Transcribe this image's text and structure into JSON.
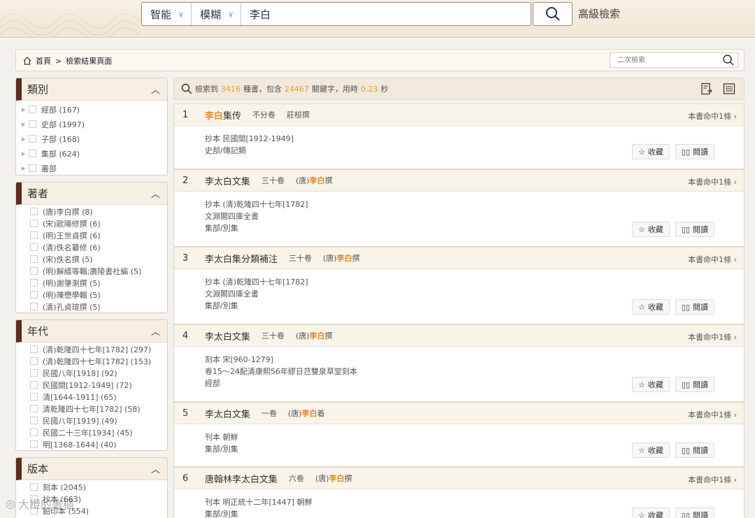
{
  "search": {
    "mode": "智能",
    "match": "模糊",
    "query": "李白",
    "advanced_label": "高級檢索"
  },
  "breadcrumb": {
    "home": "首頁",
    "sep": ">",
    "current": "檢索結果頁面",
    "sub_search_placeholder": "二次檢索"
  },
  "panels": {
    "category": {
      "title": "類別",
      "items": [
        {
          "label": "經部 (167)"
        },
        {
          "label": "史部 (1997)"
        },
        {
          "label": "子部 (168)"
        },
        {
          "label": "集部 (624)"
        },
        {
          "label": "叢部"
        }
      ]
    },
    "author": {
      "title": "著者",
      "items": [
        "(唐)李白撰 (8)",
        "(宋)歐陽修撰 (6)",
        "(明)王世貞撰 (6)",
        "(清)佚名纂修 (6)",
        "(宋)佚名撰 (5)",
        "(明)解縉等輯;廣陵書社編 (5)",
        "(明)謝肇淛撰 (5)",
        "(明)陳懋學輯 (5)",
        "(清)孔貞瑄撰 (5)"
      ]
    },
    "era": {
      "title": "年代",
      "items": [
        "(清)乾隆四十七年[1782] (297)",
        "(清)乾隆四十七年[1782] (153)",
        "民國八年[1918] (92)",
        "民國間[1912-1949] (72)",
        "清[1644-1911] (65)",
        "清乾隆四十七年[1782] (58)",
        "民國八年[1919] (49)",
        "民國二十三年[1934] (45)",
        "明[1368-1644] (40)"
      ]
    },
    "edition": {
      "title": "版本",
      "items": [
        "刻本 (2045)",
        "抄本 (663)",
        "鉛印本 (554)"
      ]
    }
  },
  "summary": {
    "p1": "檢索到",
    "books": "3416",
    "p2": "種書，包含",
    "keywords": "24467",
    "p3": "關鍵字，用時",
    "time": "0.23",
    "p4": "秒"
  },
  "results": [
    {
      "idx": "1",
      "title_hl": "李白",
      "title_rest": "集传",
      "title_pre": "",
      "vol": "不分卷",
      "auth_pre": "莊桓撰",
      "auth_hl": "",
      "auth_post": "",
      "hits": "本書命中1條",
      "lines": [
        "抄本  民國間[1912-1949]",
        "史部/傳記類"
      ]
    },
    {
      "idx": "2",
      "title_pre": "李太白文集",
      "title_hl": "",
      "title_rest": "",
      "vol": "三十卷",
      "auth_pre": "(唐)",
      "auth_hl": "李白",
      "auth_post": "撰",
      "hits": "本書命中1條",
      "lines": [
        "抄本  (清)乾隆四十七年[1782]",
        "文淵閣四庫全書",
        "集部/別集"
      ]
    },
    {
      "idx": "3",
      "title_pre": "李太白集分類補注",
      "title_hl": "",
      "title_rest": "",
      "vol": "三十卷",
      "auth_pre": "(唐)",
      "auth_hl": "李白",
      "auth_post": "撰",
      "hits": "本書命中1條",
      "lines": [
        "抄本  (清)乾隆四十七年[1782]",
        "文淵閣四庫全書",
        "集部/別集"
      ]
    },
    {
      "idx": "4",
      "title_pre": "李太白文集",
      "title_hl": "",
      "title_rest": "",
      "vol": "三十卷",
      "auth_pre": "(唐)",
      "auth_hl": "李白",
      "auth_post": "撰",
      "hits": "本書命中1條",
      "lines": [
        "刻本  宋[960-1279]",
        "卷15～24配清康熙56年繆日芑雙泉草堂刻本",
        "經部"
      ]
    },
    {
      "idx": "5",
      "title_pre": "李太白文集",
      "title_hl": "",
      "title_rest": "",
      "vol": "一卷",
      "auth_pre": "(唐)",
      "auth_hl": "李白",
      "auth_post": "着",
      "hits": "本書命中1條",
      "lines": [
        "刊本    朝鮮",
        "集部/別集"
      ]
    },
    {
      "idx": "6",
      "title_pre": "唐翰林李太白文集",
      "title_hl": "",
      "title_rest": "",
      "vol": "六卷",
      "auth_pre": "(唐)",
      "auth_hl": "李白",
      "auth_post": "撰",
      "hits": "本書命中1條",
      "lines": [
        "刊本  明正統十二年[1447]  朝鮮",
        "集部/別集"
      ]
    }
  ],
  "actions": {
    "collect": "收藏",
    "read": "閱讀"
  },
  "watermark": "大橙的書櫃",
  "colors": {
    "accent": "#e08a2a",
    "panel_bar": "#5a2d1e"
  }
}
